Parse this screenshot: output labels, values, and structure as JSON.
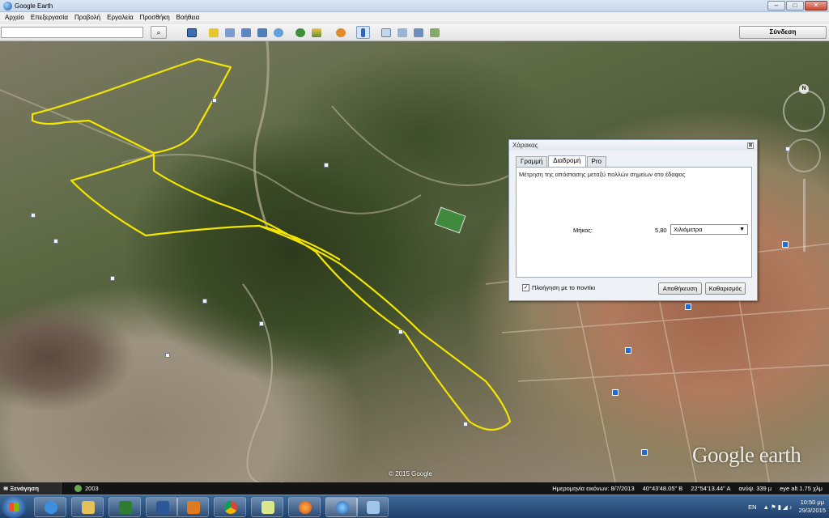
{
  "window": {
    "title": "Google Earth",
    "minimize": "–",
    "maximize": "□",
    "close": "✕"
  },
  "menu": [
    "Αρχείο",
    "Επεξεργασία",
    "Προβολή",
    "Εργαλεία",
    "Προσθήκη",
    "Βοήθεια"
  ],
  "toolbar": {
    "search_value": "",
    "search_icon": "magnifier-icon",
    "signin_label": "Σύνδεση",
    "icons": [
      "sidebar-icon",
      "placemark-icon",
      "polygon-icon",
      "path-icon",
      "image-overlay-icon",
      "record-tour-icon",
      "historical-imagery-icon",
      "sunlight-icon",
      "planets-icon",
      "ruler-icon",
      "email-icon",
      "print-icon",
      "save-image-icon",
      "maps-icon"
    ]
  },
  "map": {
    "copyright": "© 2015 Google",
    "logo": "Google earth",
    "compass_north": "N",
    "path_color": "#f2e600"
  },
  "ruler": {
    "title": "Χάρακας",
    "close_symbol": "⊠",
    "tabs": [
      "Γραμμή",
      "Διαδρομή",
      "Pro"
    ],
    "active_tab": "Διαδρομή",
    "description": "Μέτρηση της απόστασης μεταξύ πολλών σημείων στο έδαφος",
    "length_label": "Μήκος:",
    "length_value": "5,80",
    "unit": "Χιλιόμετρα",
    "mouse_nav_checked": "✓",
    "mouse_nav_label": "Πλοήγηση με το ποντίκι",
    "save_label": "Αποθήκευση",
    "clear_label": "Καθαρισμός"
  },
  "status": {
    "tour_label": "≋ Ξενάγηση",
    "year": "2003",
    "imagery_date": "Ημερομηνία εικόνων: 8/7/2013",
    "lat": "40°43'48.05\" Β",
    "lon": "22°54'13.44\" Α",
    "elevation": "ανύψ. 339 μ",
    "eye_alt": "eye alt   1.75 χλμ"
  },
  "taskbar": {
    "apps": [
      "ie-icon",
      "explorer-icon",
      "excel-icon",
      "word-icon",
      "media-player-icon",
      "chrome-icon",
      "notes-icon",
      "firefox-icon",
      "google-earth-icon",
      "paint-icon"
    ],
    "language": "EN",
    "time": "10:50 μμ",
    "date": "29/3/2015"
  }
}
